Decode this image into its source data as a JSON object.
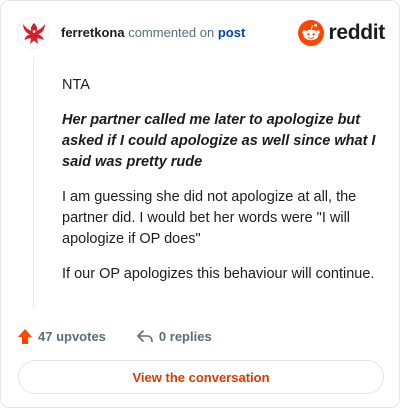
{
  "header": {
    "username": "ferretkona",
    "action_text": "commented on",
    "post_link": "post",
    "brand_word": "reddit"
  },
  "comment": {
    "paragraphs": [
      {
        "text": "NTA",
        "style": "normal"
      },
      {
        "text": "Her partner called me later to apologize but asked if I could apologize as well since what I said was pretty rude",
        "style": "quote"
      },
      {
        "text": "I am guessing she did not apologize at all, the partner did. I would bet her words were \"I will apologize if OP does\"",
        "style": "normal"
      },
      {
        "text": "If our OP apologizes this behaviour will continue.",
        "style": "normal"
      }
    ]
  },
  "footer": {
    "upvotes_label": "47 upvotes",
    "replies_label": "0 replies",
    "cta_label": "View the conversation"
  },
  "colors": {
    "accent": "#d93a00",
    "upvote": "#ff4500",
    "link": "#0045ac",
    "muted": "#576f76"
  },
  "icons": {
    "avatar": "team-valor-bird-avatar",
    "brand": "reddit-snoo-logo",
    "upvote": "upvote-arrow-icon",
    "reply": "reply-arrow-icon"
  }
}
